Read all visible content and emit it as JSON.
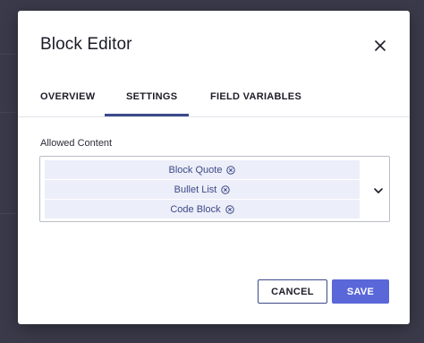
{
  "modal": {
    "title": "Block Editor"
  },
  "tabs": [
    {
      "label": "OVERVIEW",
      "active": false
    },
    {
      "label": "SETTINGS",
      "active": true
    },
    {
      "label": "FIELD VARIABLES",
      "active": false
    }
  ],
  "allowed_content": {
    "label": "Allowed Content",
    "selected": [
      {
        "label": "Block Quote"
      },
      {
        "label": "Bullet List"
      },
      {
        "label": "Code Block"
      }
    ]
  },
  "footer": {
    "cancel_label": "CANCEL",
    "save_label": "SAVE"
  },
  "colors": {
    "accent": "#5a67d8",
    "tab_indicator": "#3b4a8a",
    "chip_bg": "#eceef9",
    "chip_text": "#3d4a88",
    "overlay": "#3a3a4a"
  },
  "icons": {
    "close": "close-icon",
    "chip_remove": "circle-x-icon",
    "dropdown": "chevron-down-icon"
  }
}
